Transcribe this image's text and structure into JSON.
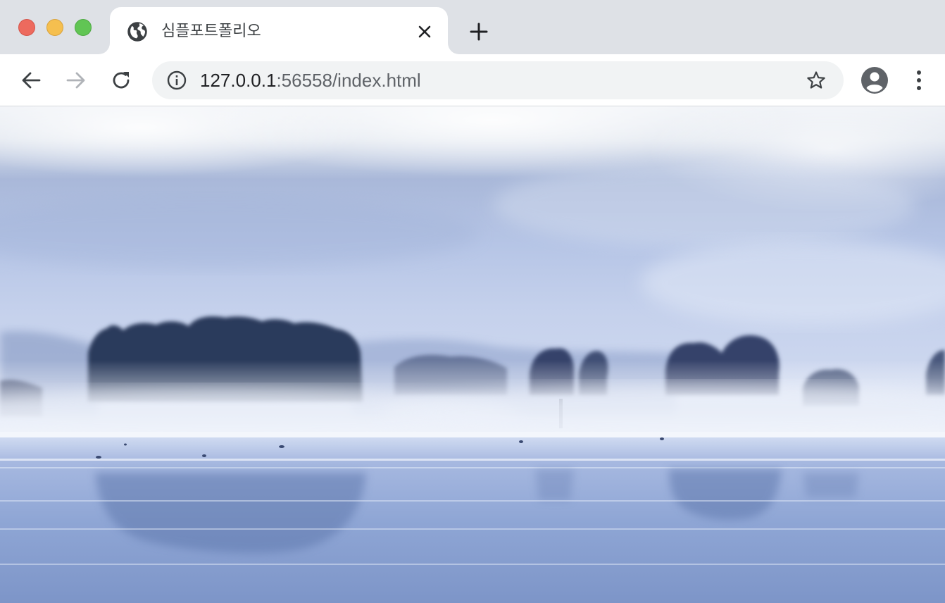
{
  "window": {
    "traffic_lights": [
      "close",
      "minimize",
      "zoom"
    ]
  },
  "tab": {
    "title": "심플포트폴리오",
    "favicon_icon": "globe-icon",
    "close_icon": "close-icon"
  },
  "toolbar": {
    "back_icon": "arrow-left-icon",
    "forward_icon": "arrow-right-icon",
    "reload_icon": "reload-icon",
    "url_host": "127.0.0.1",
    "url_rest": ":56558/index.html",
    "info_icon": "info-icon",
    "bookmark_icon": "star-icon",
    "profile_icon": "account-circle-icon",
    "menu_icon": "kebab-menu-icon"
  },
  "page": {
    "hero_image": "misty lake landscape photograph",
    "colors": {
      "sky": "#b7c6e6",
      "fog": "#e9eef8",
      "trees": "#2c3a5c",
      "water": "#8ea4d2"
    }
  }
}
